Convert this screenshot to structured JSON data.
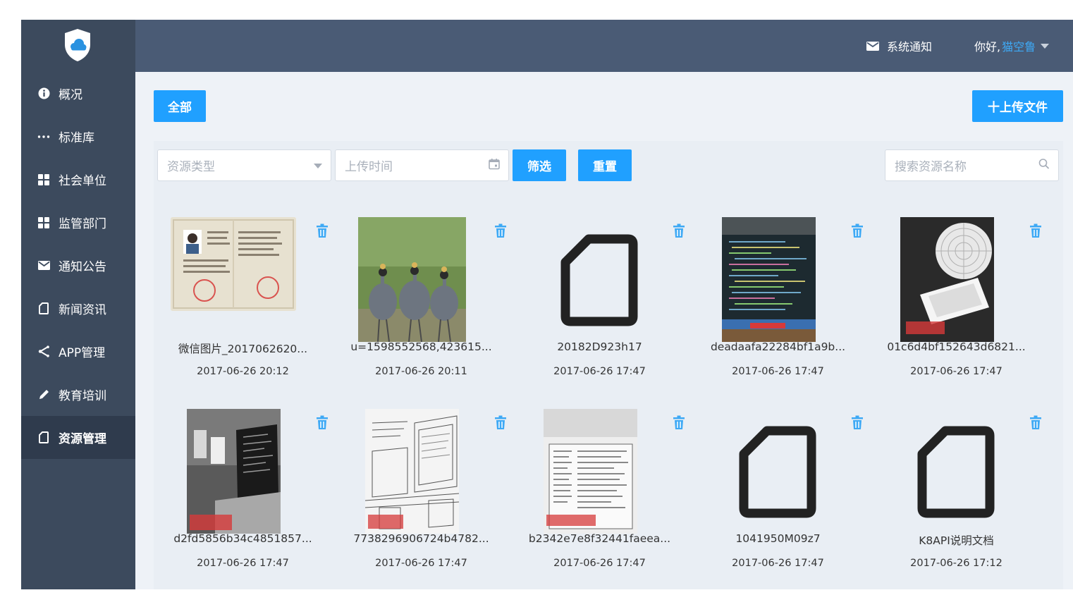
{
  "sidebar": {
    "items": [
      {
        "label": "概况",
        "icon": "info-circle-icon"
      },
      {
        "label": "标准库",
        "icon": "more-dots-icon"
      },
      {
        "label": "社会单位",
        "icon": "grid-icon"
      },
      {
        "label": "监管部门",
        "icon": "grid-icon"
      },
      {
        "label": "通知公告",
        "icon": "envelope-icon"
      },
      {
        "label": "新闻资讯",
        "icon": "document-icon"
      },
      {
        "label": "APP管理",
        "icon": "share-icon"
      },
      {
        "label": "教育培训",
        "icon": "pencil-icon"
      },
      {
        "label": "资源管理",
        "icon": "document-icon"
      }
    ],
    "active_index": 8
  },
  "header": {
    "notify_label": "系统通知",
    "greeting": "你好,",
    "username": "猫空鲁"
  },
  "toolbar": {
    "all_label": "全部",
    "upload_label": "十上传文件"
  },
  "filters": {
    "type_placeholder": "资源类型",
    "time_placeholder": "上传时间",
    "filter_label": "筛选",
    "reset_label": "重置",
    "search_placeholder": "搜索资源名称"
  },
  "colors": {
    "primary": "#20a0ff",
    "sidebar": "#3c4a5d",
    "header": "#4a5b75",
    "username": "#3ea9f5"
  },
  "files": [
    {
      "name": "微信图片_2017062620...",
      "date": "2017-06-26 20:12",
      "thumb": "certificate-photo"
    },
    {
      "name": "u=1598552568,423615...",
      "date": "2017-06-26 20:11",
      "thumb": "cranes-photo"
    },
    {
      "name": "20182D923h17",
      "date": "2017-06-26 17:47",
      "thumb": "file-icon"
    },
    {
      "name": "deadaafa22284bf1a9b...",
      "date": "2017-06-26 17:47",
      "thumb": "code-screen-photo"
    },
    {
      "name": "01c6d4bf152643d6821...",
      "date": "2017-06-26 17:47",
      "thumb": "fan-phone-photo"
    },
    {
      "name": "d2fd5856b34c4851857...",
      "date": "2017-06-26 17:47",
      "thumb": "laptop-desk-photo"
    },
    {
      "name": "7738296906724b4782...",
      "date": "2017-06-26 17:47",
      "thumb": "office-sketch-photo"
    },
    {
      "name": "b2342e7e8f32441faeea...",
      "date": "2017-06-26 17:47",
      "thumb": "document-scan-photo"
    },
    {
      "name": "1041950M09z7",
      "date": "2017-06-26 17:47",
      "thumb": "file-icon"
    },
    {
      "name": "K8API说明文档",
      "date": "2017-06-26 17:12",
      "thumb": "file-icon"
    }
  ]
}
